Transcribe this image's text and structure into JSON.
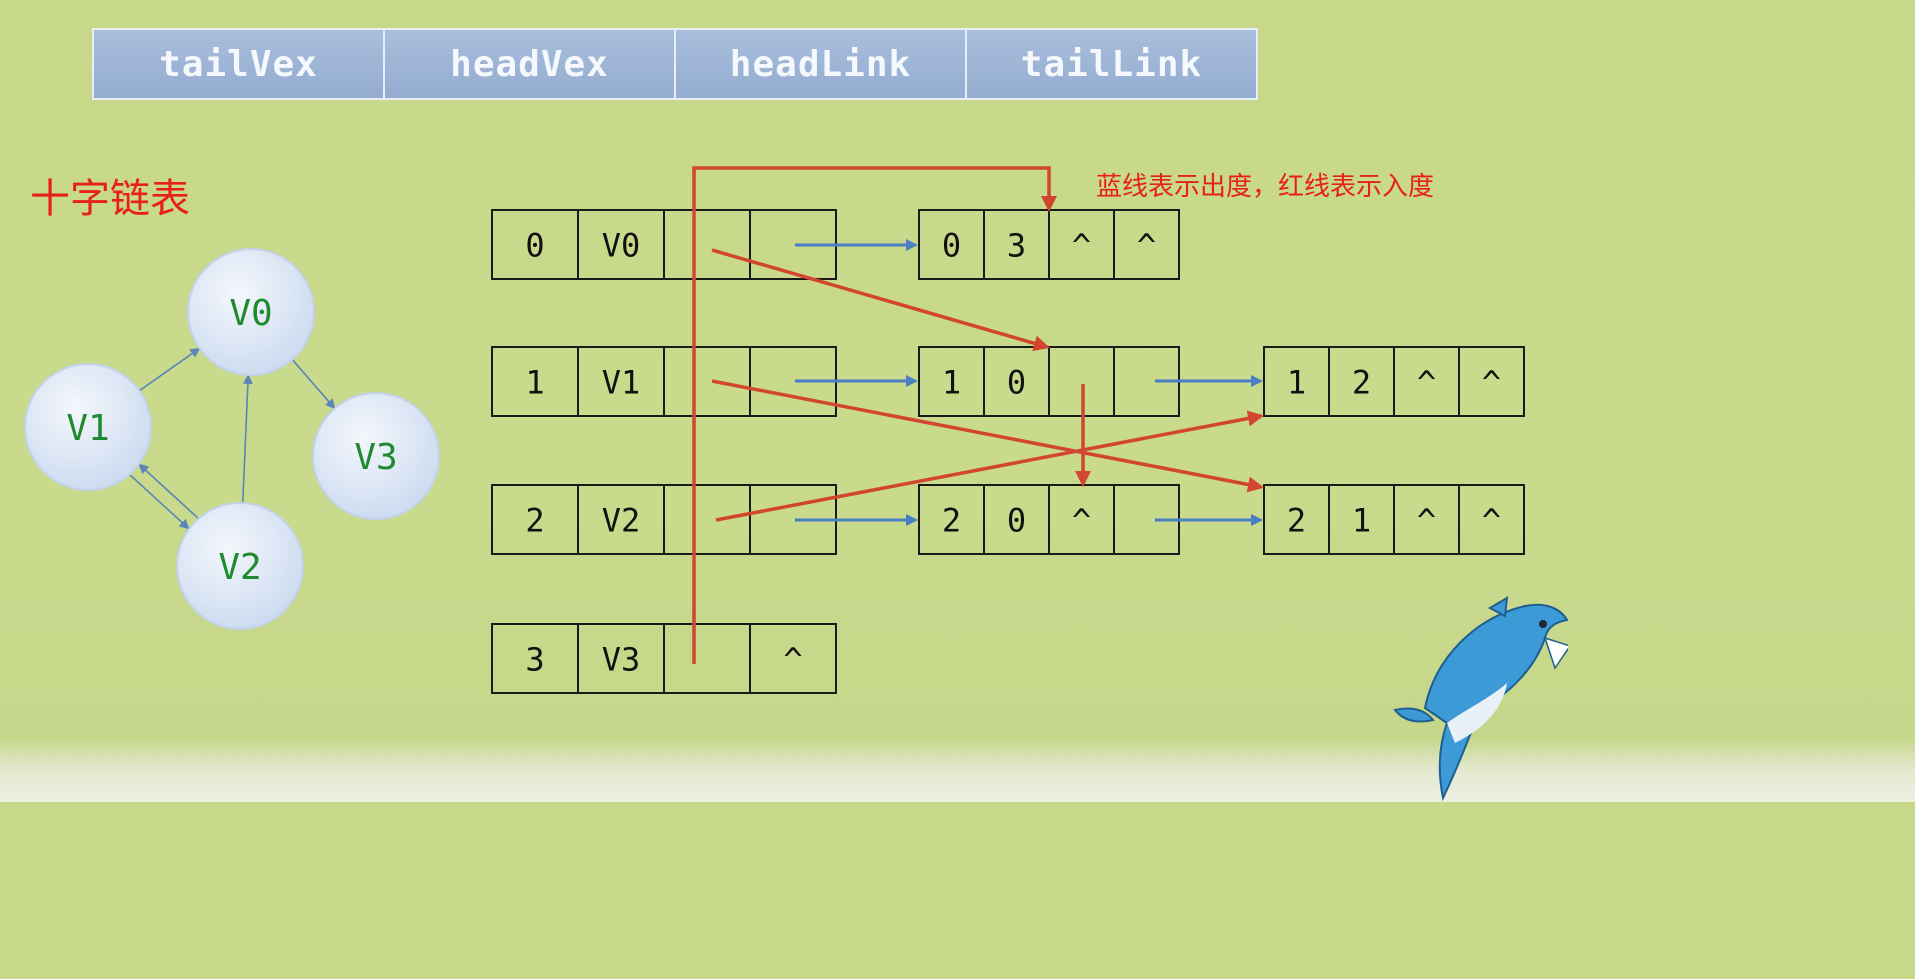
{
  "header": {
    "columns": [
      "tailVex",
      "headVex",
      "headLink",
      "tailLink"
    ]
  },
  "title": "十字链表",
  "legend": "蓝线表示出度，红线表示入度",
  "graph": {
    "nodes": [
      "V0",
      "V1",
      "V2",
      "V3"
    ],
    "edges": [
      {
        "from": "V1",
        "to": "V0"
      },
      {
        "from": "V1",
        "to": "V2"
      },
      {
        "from": "V2",
        "to": "V1"
      },
      {
        "from": "V2",
        "to": "V0"
      },
      {
        "from": "V0",
        "to": "V3"
      }
    ]
  },
  "vertex_table": [
    {
      "index": "0",
      "name": "V0",
      "first_in": "",
      "first_out": ""
    },
    {
      "index": "1",
      "name": "V1",
      "first_in": "",
      "first_out": ""
    },
    {
      "index": "2",
      "name": "V2",
      "first_in": "",
      "first_out": ""
    },
    {
      "index": "3",
      "name": "V3",
      "first_in": "",
      "first_out": "^"
    }
  ],
  "arc_nodes": [
    {
      "id": "arc-0-3",
      "cells": [
        "0",
        "3",
        "^",
        "^"
      ]
    },
    {
      "id": "arc-1-0",
      "cells": [
        "1",
        "0",
        "",
        ""
      ]
    },
    {
      "id": "arc-1-2",
      "cells": [
        "1",
        "2",
        "^",
        "^"
      ]
    },
    {
      "id": "arc-2-0",
      "cells": [
        "2",
        "0",
        "^",
        ""
      ]
    },
    {
      "id": "arc-2-1",
      "cells": [
        "2",
        "1",
        "^",
        "^"
      ]
    }
  ],
  "colors": {
    "out_degree_line": "#4a7fc4",
    "in_degree_line": "#d2452f",
    "node_fill": "#dfe8f6",
    "node_text": "#1f8a2e",
    "title_text": "#e8201c"
  },
  "decoration": {
    "mascot": "shark-icon"
  }
}
